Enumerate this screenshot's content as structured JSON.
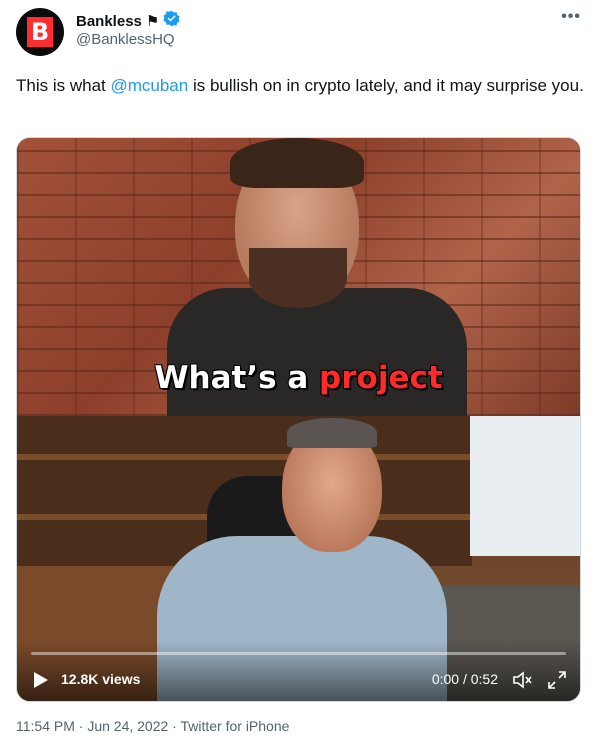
{
  "account": {
    "display_name": "Bankless",
    "handle": "@BanklessHQ",
    "avatar_letter": "B",
    "flag_glyph": "⚑"
  },
  "tweet": {
    "text_before": "This is what ",
    "mention": "@mcuban",
    "text_after": " is bullish on in crypto lately, and it may surprise you."
  },
  "video": {
    "caption_white": "What’s a ",
    "caption_red": "project",
    "views": "12.8K views",
    "time": "0:00 / 0:52",
    "progress": 0
  },
  "footer": {
    "meta": "11:54 PM · Jun 24, 2022 · Twitter for iPhone"
  },
  "colors": {
    "accent": "#1d9bf0",
    "muted": "#536471",
    "caption_highlight": "#ff2a2a",
    "logo_red": "#ff2d2d"
  }
}
